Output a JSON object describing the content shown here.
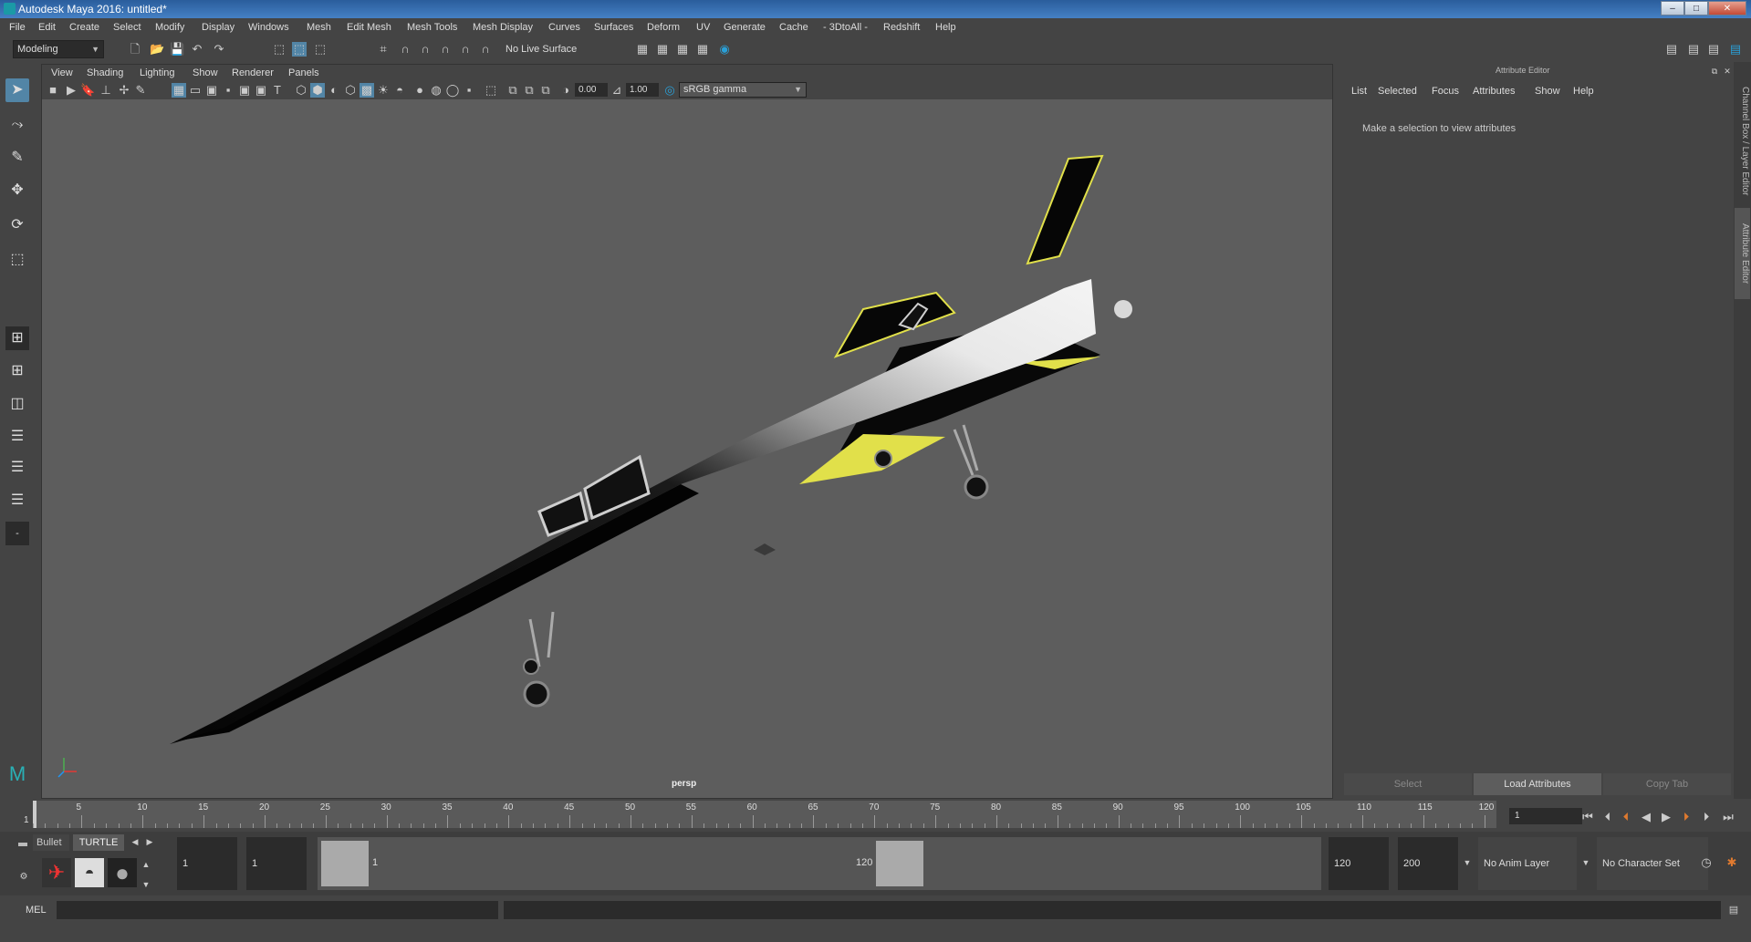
{
  "window": {
    "title": "Autodesk Maya 2016: untitled*",
    "min": "–",
    "max": "□",
    "close": "✕"
  },
  "menubar": [
    "File",
    "Edit",
    "Create",
    "Select",
    "Modify",
    "Display",
    "Windows",
    "Mesh",
    "Edit Mesh",
    "Mesh Tools",
    "Mesh Display",
    "Curves",
    "Surfaces",
    "Deform",
    "UV",
    "Generate",
    "Cache",
    "- 3DtoAll -",
    "Redshift",
    "Help"
  ],
  "shelf": {
    "mode": "Modeling",
    "live_surface": "No Live Surface"
  },
  "viewport": {
    "menu": [
      "View",
      "Shading",
      "Lighting",
      "Show",
      "Renderer",
      "Panels"
    ],
    "exposure": "0.00",
    "gamma": "1.00",
    "color_space": "sRGB gamma",
    "camera_label": "persp"
  },
  "attribute_editor": {
    "header": "Attribute Editor",
    "menu": [
      "List",
      "Selected",
      "Focus",
      "Attributes",
      "Show",
      "Help"
    ],
    "message": "Make a selection to view attributes",
    "buttons": [
      "Select",
      "Load Attributes",
      "Copy Tab"
    ]
  },
  "side_tabs": [
    "Channel Box / Layer Editor",
    "Attribute Editor"
  ],
  "timeline": {
    "ticks": [
      "5",
      "10",
      "15",
      "20",
      "25",
      "30",
      "35",
      "40",
      "45",
      "50",
      "55",
      "60",
      "65",
      "70",
      "75",
      "80",
      "85",
      "90",
      "95",
      "100",
      "105",
      "110",
      "115",
      "120"
    ],
    "start_label": "1",
    "current_frame": "1"
  },
  "shelf_tabs": {
    "bullet": "Bullet",
    "turtle": "TURTLE"
  },
  "range": {
    "start": "1",
    "playback_start": "1",
    "slider_start": "1",
    "slider_end": "120",
    "playback_end": "120",
    "end": "200",
    "anim_layer": "No Anim Layer",
    "character_set": "No Character Set"
  },
  "cmdline": {
    "label": "MEL"
  },
  "colors": {
    "accent": "#5285a6",
    "title": "#2a5d9c",
    "viewport": "#5d5d5d",
    "jet_trim": "#e1e04a"
  }
}
